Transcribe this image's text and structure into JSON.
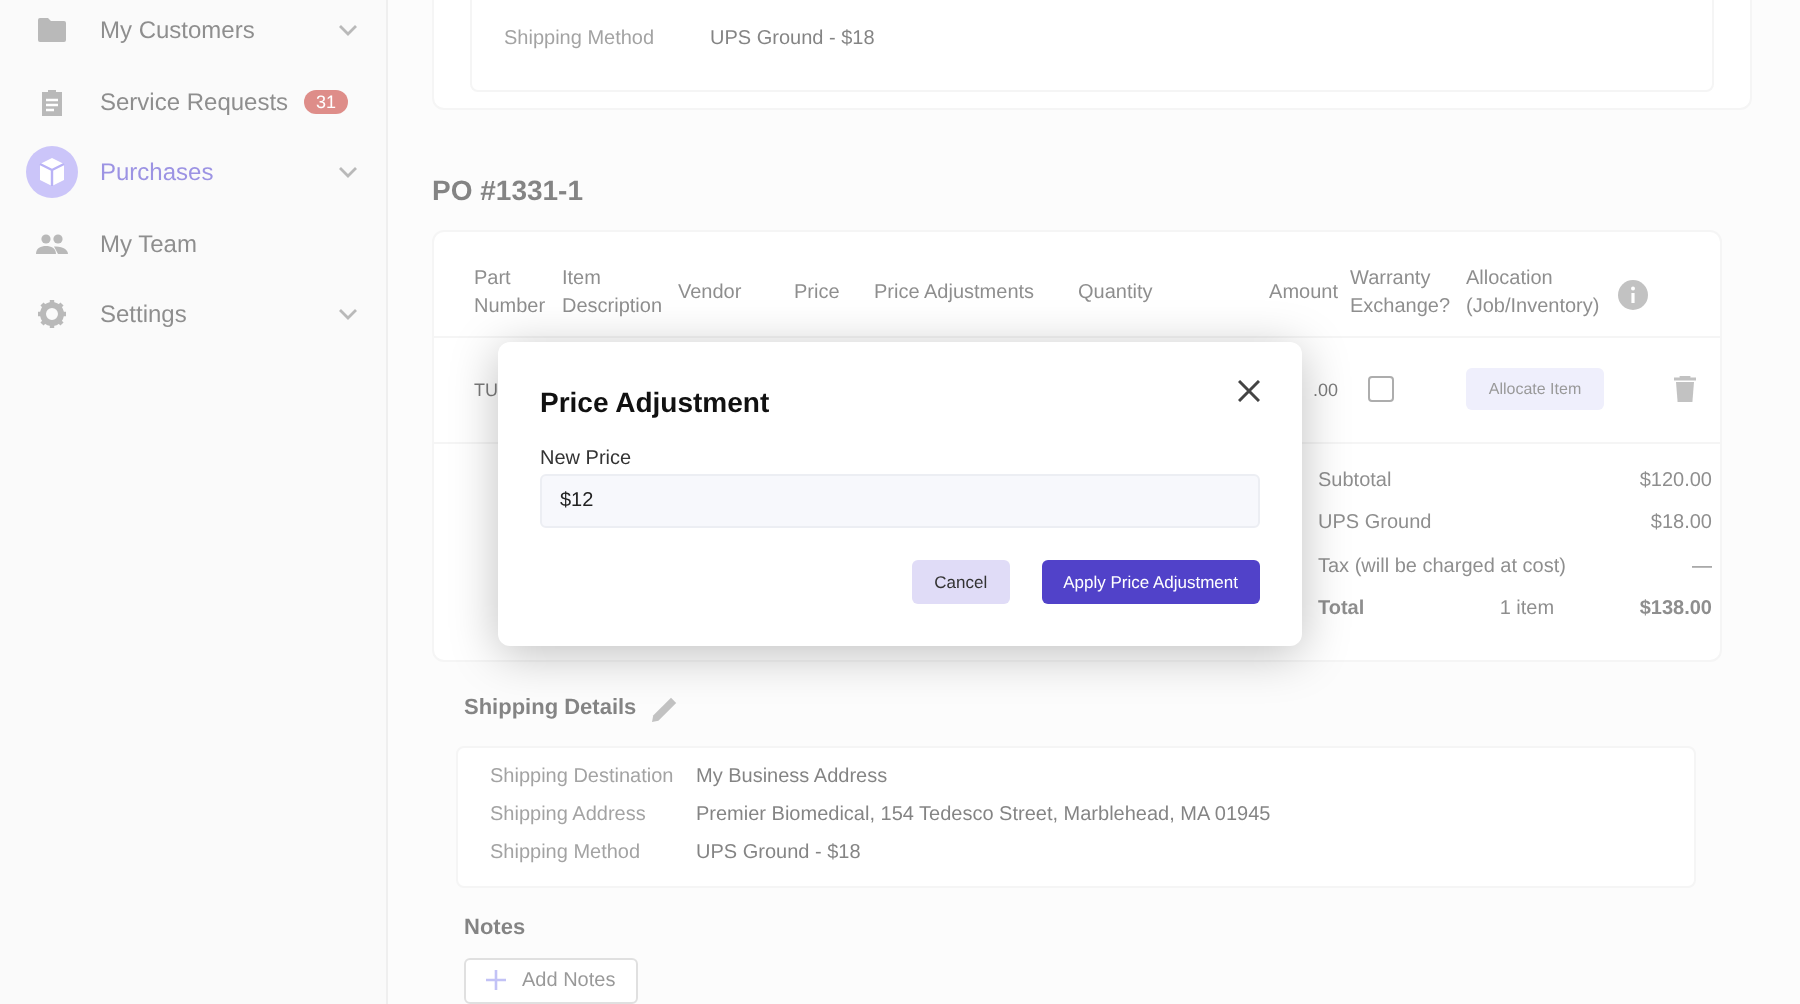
{
  "sidebar": {
    "items": [
      {
        "label": "My Customers",
        "selected": false,
        "expandable": true
      },
      {
        "label": "Service Requests",
        "selected": false,
        "expandable": false,
        "badge": "31"
      },
      {
        "label": "Purchases",
        "selected": true,
        "expandable": true
      },
      {
        "label": "My Team",
        "selected": false,
        "expandable": false
      },
      {
        "label": "Settings",
        "selected": false,
        "expandable": true
      }
    ]
  },
  "top_card": {
    "rows": [
      {
        "label": "Shipping Method",
        "value": "UPS Ground - $18"
      }
    ]
  },
  "po_title": "PO #1331-1",
  "table": {
    "columns": [
      "Part Number",
      "Item Description",
      "Vendor",
      "Price",
      "Price Adjustments",
      "Quantity",
      "Amount",
      "Warranty Exchange?",
      "Allocation (Job/Inventory)"
    ],
    "rows": [
      {
        "part_number": "TU",
        "amount": ".00",
        "warranty_exchange": false,
        "action": "Allocate Item"
      }
    ]
  },
  "summary": {
    "rows": [
      {
        "label": "Subtotal",
        "value": "$120.00"
      },
      {
        "label": "UPS Ground",
        "value": "$18.00"
      },
      {
        "label": "Tax (will be charged at cost)",
        "value": "—"
      }
    ],
    "total": {
      "label": "Total",
      "count": "1 item",
      "value": "$138.00"
    }
  },
  "shipping_details": {
    "title": "Shipping Details",
    "rows": [
      {
        "label": "Shipping Destination",
        "value": "My Business Address"
      },
      {
        "label": "Shipping Address",
        "value": "Premier Biomedical, 154 Tedesco Street, Marblehead, MA 01945"
      },
      {
        "label": "Shipping Method",
        "value": "UPS Ground - $18"
      }
    ]
  },
  "notes": {
    "title": "Notes",
    "button": "Add Notes"
  },
  "dialog": {
    "title": "Price Adjustment",
    "field_label": "New Price",
    "field_value": "$12",
    "buttons": [
      {
        "label": "Cancel",
        "kind": "secondary"
      },
      {
        "label": "Apply Price Adjustment",
        "kind": "primary"
      }
    ]
  }
}
